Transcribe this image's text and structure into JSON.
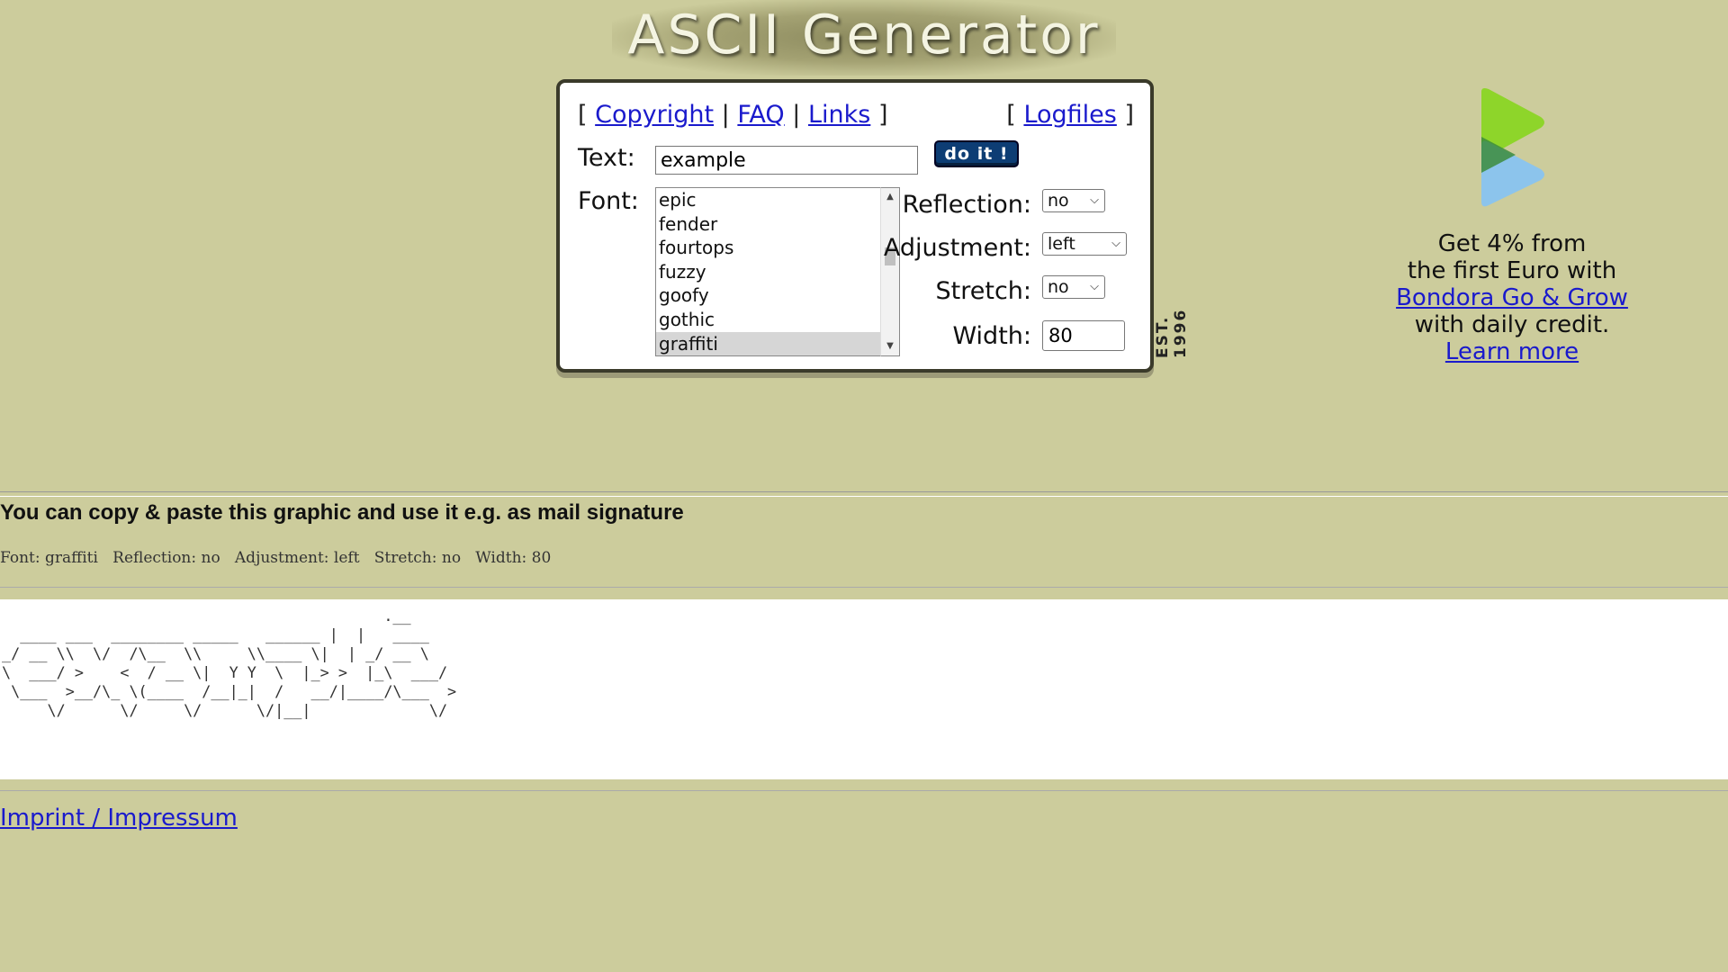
{
  "header": {
    "title": "ASCII Generator"
  },
  "nav": {
    "left_links": [
      "Copyright",
      "FAQ",
      "Links"
    ],
    "right_link": "Logfiles",
    "bracket_open": "[",
    "bracket_close": "]",
    "separator": "|"
  },
  "form": {
    "text_label": "Text:",
    "text_value": "example",
    "submit_label": "do it !",
    "font_label": "Font:",
    "font_options": [
      "epic",
      "fender",
      "fourtops",
      "fuzzy",
      "goofy",
      "gothic",
      "graffiti"
    ],
    "font_selected": "graffiti",
    "reflection_label": "Reflection:",
    "reflection_value": "no",
    "adjustment_label": "Adjustment:",
    "adjustment_value": "left",
    "stretch_label": "Stretch:",
    "stretch_value": "no",
    "width_label": "Width:",
    "width_value": "80",
    "est": "EST. 1996"
  },
  "ad": {
    "line1": "Get 4% from",
    "line2": "the first Euro with",
    "link": "Bondora Go & Grow",
    "line3": "with daily credit.",
    "learn_more": "Learn more",
    "colors": {
      "green": "#8ed52a",
      "blue": "#8cc4ec",
      "dark_green": "#3c8c3c"
    }
  },
  "result": {
    "copy_note": "You can copy & paste this graphic and use it e.g. as mail signature",
    "settings_line": "Font: graffiti   Reflection: no   Adjustment: left   Stretch: no   Width: 80",
    "ascii_art": "                                          .__\n  ____ ___  ________ _____   ______ |  |   ____\n_/ __ \\\\  \\/  /\\__  \\\\     \\\\____ \\|  | _/ __ \\\n\\  ___/ >    <  / __ \\|  Y Y  \\  |_> >  |_\\  ___/\n \\___  >__/\\_ \\(____  /__|_|  /   __/|____/\\___  >\n     \\/      \\/     \\/      \\/|__|             \\/"
  },
  "footer": {
    "imprint": "Imprint / Impressum"
  }
}
